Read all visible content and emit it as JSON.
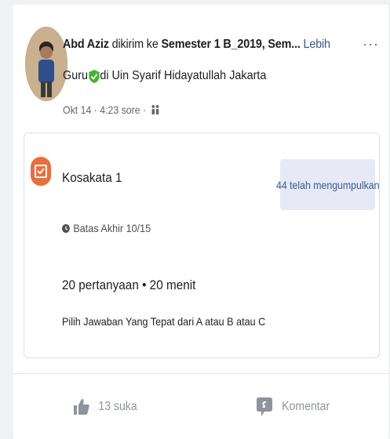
{
  "post": {
    "author": "Abd Aziz",
    "sent_to_text": "dikirim ke",
    "group_name": "Semester 1 B_2019,",
    "group_truncated": "Sem...",
    "more_link": "Lebih",
    "role_before": "Guru",
    "role_after": "di Uin Syarif Hidayatullah Jakarta",
    "timestamp": "Okt 14 · 4:23 sore ·"
  },
  "assignment": {
    "title": "Kosakata 1",
    "submitted_label": "44 telah mengumpulkan",
    "deadline": "Batas Akhir 10/15",
    "question_info": "20 pertanyaan • 20 menit",
    "instructions": "Pilih Jawaban Yang Tepat dari A atau B atau C"
  },
  "actions": {
    "like_label": "13 suka",
    "comment_label": "Komentar"
  },
  "colors": {
    "accent": "#ef6c3a",
    "verified": "#42b72a",
    "link": "#3b5998"
  },
  "icons": [
    "more-icon",
    "verified-icon",
    "group-audience-icon",
    "assignment-icon",
    "clock-icon",
    "like-icon",
    "comment-icon"
  ]
}
